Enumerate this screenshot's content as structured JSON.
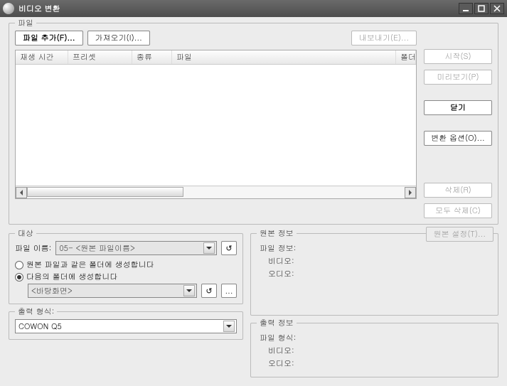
{
  "window": {
    "title": "비디오 변환",
    "min_tip": "_",
    "max_tip": "□",
    "close_tip": "×"
  },
  "file_group": {
    "legend": "파일",
    "add_label": "파일 추가(F)...",
    "import_label": "가져오기(I)...",
    "export_label": "내보내기(E)...",
    "columns": {
      "playtime": "재생 시간",
      "preset": "프리셋",
      "kind": "종류",
      "file": "파일",
      "folder": "폴더"
    }
  },
  "side": {
    "start": "시작(S)",
    "preview": "미리보기(P)",
    "close": "닫기",
    "options": "변환 옵션(O)...",
    "delete": "삭제(R)",
    "delete_all": "모두 삭제(C)"
  },
  "target": {
    "legend": "대상",
    "filename_label": "파일 이름:",
    "filename_value": "05- <원본 파일이름>",
    "radio_same": "원본 파일과 같은 폴더에 생성합니다",
    "radio_custom": "다음의 폴더에 생성합니다",
    "folder_value": "<바탕화면>"
  },
  "output_format": {
    "legend": "출력 형식:",
    "value": "COWON Q5"
  },
  "origin": {
    "legend": "원본 정보",
    "settings": "원본 설정(T)...",
    "fileinfo": "파일 정보:",
    "video": "비디오:",
    "audio": "오디오:"
  },
  "outinfo": {
    "legend": "출력 정보",
    "fileformat": "파일 형식:",
    "video": "비디오:",
    "audio": "오디오:"
  },
  "glyphs": {
    "undo": "↺",
    "browse": "..."
  }
}
